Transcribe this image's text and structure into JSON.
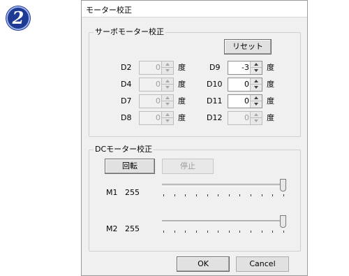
{
  "step_badge": "2",
  "dialog": {
    "title": "モーター校正",
    "servo": {
      "group_title": "サーボモーター校正",
      "reset_label": "リセット",
      "unit": "度",
      "items": [
        {
          "label": "D2",
          "value": "0",
          "enabled": false
        },
        {
          "label": "D9",
          "value": "-3",
          "enabled": true
        },
        {
          "label": "D4",
          "value": "0",
          "enabled": false
        },
        {
          "label": "D10",
          "value": "0",
          "enabled": true
        },
        {
          "label": "D7",
          "value": "0",
          "enabled": false
        },
        {
          "label": "D11",
          "value": "0",
          "enabled": true
        },
        {
          "label": "D8",
          "value": "0",
          "enabled": false
        },
        {
          "label": "D12",
          "value": "0",
          "enabled": false
        }
      ]
    },
    "dc": {
      "group_title": "DCモーター校正",
      "rotate_label": "回転",
      "stop_label": "停止",
      "m1": {
        "label": "M1",
        "value": "255",
        "level": 1.0
      },
      "m2": {
        "label": "M2",
        "value": "255",
        "level": 1.0
      }
    },
    "ok_label": "OK",
    "cancel_label": "Cancel"
  }
}
